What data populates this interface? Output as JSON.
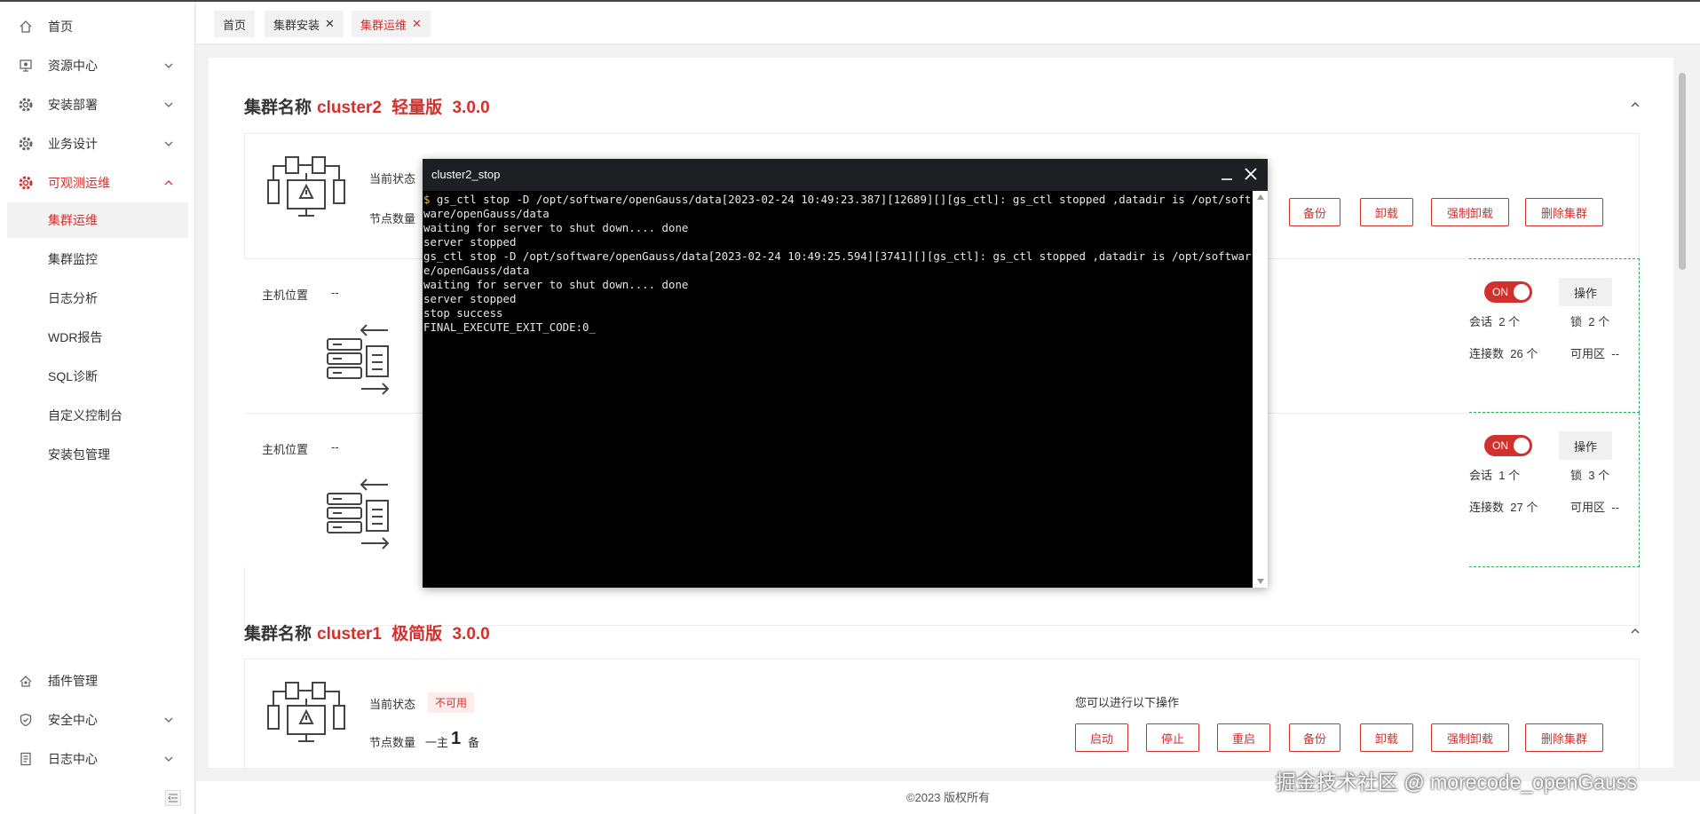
{
  "sidebar": {
    "items": [
      {
        "label": "首页",
        "icon": "home-icon"
      },
      {
        "label": "资源中心",
        "icon": "resource-icon"
      },
      {
        "label": "安装部署",
        "icon": "gear-icon"
      },
      {
        "label": "业务设计",
        "icon": "gear-icon"
      },
      {
        "label": "可观测运维",
        "icon": "gear-icon"
      }
    ],
    "sub_items": [
      "集群运维",
      "集群监控",
      "日志分析",
      "WDR报告",
      "SQL诊断",
      "自定义控制台",
      "安装包管理"
    ],
    "bottom_items": [
      {
        "label": "插件管理",
        "icon": "plugin-icon"
      },
      {
        "label": "安全中心",
        "icon": "shield-icon"
      },
      {
        "label": "日志中心",
        "icon": "document-icon"
      }
    ]
  },
  "tabs": [
    {
      "label": "首页",
      "closable": false
    },
    {
      "label": "集群安装",
      "closable": true
    },
    {
      "label": "集群运维",
      "closable": true
    }
  ],
  "clusters": [
    {
      "title_prefix": "集群名称",
      "name": "cluster2",
      "edition": "轻量版",
      "version": "3.0.0"
    },
    {
      "title_prefix": "集群名称",
      "name": "cluster1",
      "edition": "极简版",
      "version": "3.0.0"
    }
  ],
  "cluster_card": {
    "state_label": "当前状态",
    "state_value": "不可用",
    "node_label": "节点数量",
    "node_primary": "一主",
    "node_count": "1",
    "node_standby": "备",
    "ops_label": "您可以进行以下操作",
    "ops": [
      "启动",
      "停止",
      "重启",
      "备份",
      "卸载",
      "强制卸载",
      "删除集群"
    ]
  },
  "hosts": [
    {
      "host_label": "主机位置",
      "host_value": "--",
      "toggle": "ON",
      "op": "操作",
      "session_label": "会话",
      "session": "2",
      "lock_label": "锁",
      "lock": "2",
      "unit": "个",
      "conn_label": "连接数",
      "conn": "26",
      "az_label": "可用区",
      "az": "--"
    },
    {
      "host_label": "主机位置",
      "host_value": "--",
      "toggle": "ON",
      "op": "操作",
      "session_label": "会话",
      "session": "1",
      "lock_label": "锁",
      "lock": "3",
      "unit": "个",
      "conn_label": "连接数",
      "conn": "27",
      "az_label": "可用区",
      "az": "--"
    }
  ],
  "partial_labels": {
    "state": "当前状态",
    "node": "节点数量"
  },
  "terminal": {
    "title": "cluster2_stop",
    "prompt": "$",
    "lines": [
      " gs_ctl stop -D /opt/software/openGauss/data[2023-02-24 10:49:23.387][12689][][gs_ctl]: gs_ctl stopped ,datadir is /opt/software/openGauss/data",
      "waiting for server to shut down.... done",
      "server stopped",
      "gs_ctl stop -D /opt/software/openGauss/data[2023-02-24 10:49:25.594][3741][][gs_ctl]: gs_ctl stopped ,datadir is /opt/software/openGauss/data",
      "waiting for server to shut down.... done",
      "server stopped",
      "stop success",
      "FINAL_EXECUTE_EXIT_CODE:0_"
    ]
  },
  "footer": "©2023 版权所有",
  "watermark": "掘金技术社区 @ morecode_openGauss",
  "colors": {
    "accent": "#d0312d",
    "dashed_border": "#2fae5b",
    "terminal_bg": "#000000",
    "terminal_header": "#1d1f23"
  }
}
